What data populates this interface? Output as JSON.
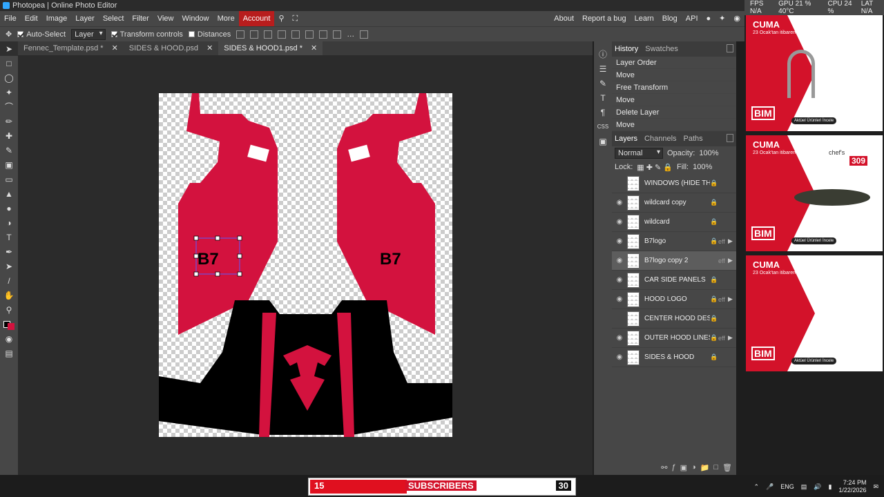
{
  "window_title": "Photopea | Online Photo Editor",
  "menu": {
    "items": [
      "File",
      "Edit",
      "Image",
      "Layer",
      "Select",
      "Filter",
      "View",
      "Window",
      "More"
    ],
    "account": "Account",
    "right": [
      "About",
      "Report a bug",
      "Learn",
      "Blog",
      "API"
    ]
  },
  "sysinfo": {
    "fps": "FPS N/A",
    "gpu": "GPU 21 % 40°C",
    "cpu": "CPU 24 %",
    "lat": "LAT N/A"
  },
  "options": {
    "auto_select": "Auto-Select",
    "auto_select_target": "Layer",
    "transform_controls": "Transform controls",
    "distances": "Distances"
  },
  "tabs": [
    {
      "label": "Fennec_Template.psd *",
      "active": false
    },
    {
      "label": "SIDES & HOOD.psd",
      "active": false
    },
    {
      "label": "SIDES & HOOD1.psd *",
      "active": true
    }
  ],
  "history": {
    "tabs": [
      "History",
      "Swatches"
    ],
    "items": [
      "Layer Order",
      "Move",
      "Free Transform",
      "Move",
      "Delete Layer",
      "Move"
    ]
  },
  "layers_panel": {
    "tabs": [
      "Layers",
      "Channels",
      "Paths"
    ],
    "blend_mode": "Normal",
    "opacity_label": "Opacity:",
    "opacity": "100%",
    "lock_label": "Lock:",
    "fill_label": "Fill:",
    "fill": "100%",
    "layers": [
      {
        "name": "WINDOWS (HIDE THIS)",
        "visible": false,
        "locked": true,
        "eff": false,
        "group": false
      },
      {
        "name": "wildcard copy",
        "visible": true,
        "locked": true,
        "eff": false,
        "group": false
      },
      {
        "name": "wildcard",
        "visible": true,
        "locked": true,
        "eff": false,
        "group": false
      },
      {
        "name": "B7logo",
        "visible": true,
        "locked": true,
        "eff": true,
        "group": true
      },
      {
        "name": "B7logo copy 2",
        "visible": true,
        "locked": false,
        "eff": true,
        "group": true,
        "selected": true
      },
      {
        "name": "CAR SIDE PANELS",
        "visible": true,
        "locked": true,
        "eff": false,
        "group": false
      },
      {
        "name": "HOOD LOGO",
        "visible": true,
        "locked": true,
        "eff": true,
        "group": true
      },
      {
        "name": "CENTER HOOD DESIGN",
        "visible": false,
        "locked": true,
        "eff": false,
        "group": false
      },
      {
        "name": "OUTER HOOD LINES",
        "visible": true,
        "locked": true,
        "eff": true,
        "group": true
      },
      {
        "name": "SIDES & HOOD",
        "visible": true,
        "locked": true,
        "eff": false,
        "group": false
      }
    ]
  },
  "ads": [
    {
      "title": "CUMA",
      "sub": "23 Ocak'tan itibaren",
      "brand": "BIM",
      "button": "Aktüel Ürünleri İncele"
    },
    {
      "title": "CUMA",
      "sub": "23 Ocak'tan itibaren",
      "brand": "BIM",
      "button": "Aktüel Ürünleri İncele",
      "product": "chef's",
      "price": "309"
    },
    {
      "title": "CUMA",
      "sub": "23 Ocak'tan itibaren",
      "brand": "BIM",
      "button": "Aktüel Ürünleri İncele"
    }
  ],
  "subscriber_bar": {
    "left": "15",
    "label": "SUBSCRIBERS",
    "right": "30"
  },
  "tray": {
    "lang": "ENG",
    "time": "7:24 PM",
    "date": "1/22/2026"
  },
  "colors": {
    "accent": "#d3123e",
    "account_red": "#b81d1d",
    "panel": "#474747"
  }
}
